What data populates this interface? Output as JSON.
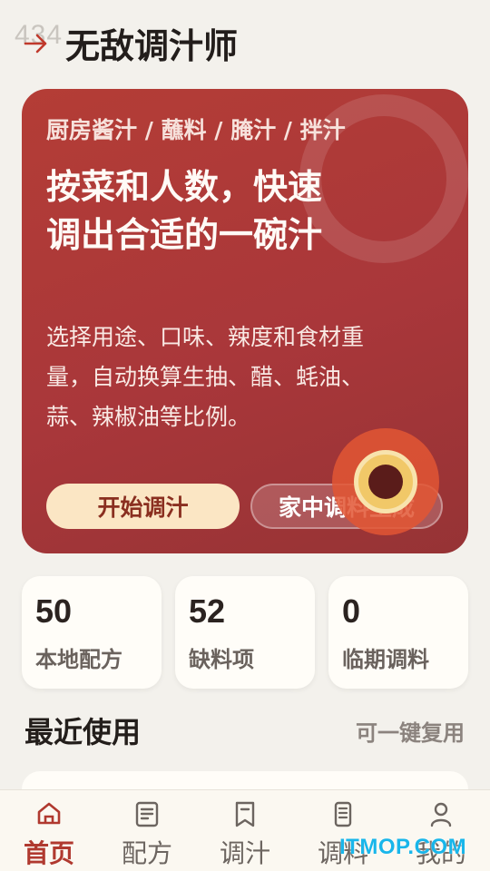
{
  "header": {
    "status_ghost": "434",
    "title": "无敌调汁师"
  },
  "hero": {
    "tags": "厨房酱汁 / 蘸料 / 腌汁 / 拌汁",
    "headline": "按菜和人数，快速调出合适的一碗汁",
    "description": "选择用途、口味、辣度和食材重量，自动换算生抽、醋、蚝油、蒜、辣椒油等比例。",
    "start_button": "开始调汁",
    "generate_button": "家中调料生成"
  },
  "stats": [
    {
      "value": "50",
      "label": "本地配方"
    },
    {
      "value": "52",
      "label": "缺料项"
    },
    {
      "value": "0",
      "label": "临期调料"
    }
  ],
  "recent": {
    "title": "最近使用",
    "action": "可一键复用"
  },
  "nav": {
    "items": [
      {
        "label": "首页",
        "icon": "home-icon",
        "active": true
      },
      {
        "label": "配方",
        "icon": "document-icon",
        "active": false
      },
      {
        "label": "调汁",
        "icon": "bookmark-icon",
        "active": false
      },
      {
        "label": "调料",
        "icon": "bottle-icon",
        "active": false
      },
      {
        "label": "我的",
        "icon": "person-icon",
        "active": false
      }
    ]
  },
  "watermark": "ITMOP.COM",
  "colors": {
    "accent": "#b0392f",
    "hero_background": "#a9373a",
    "start_button_bg": "#fbe6c4",
    "page_background": "#f3f1ec"
  }
}
